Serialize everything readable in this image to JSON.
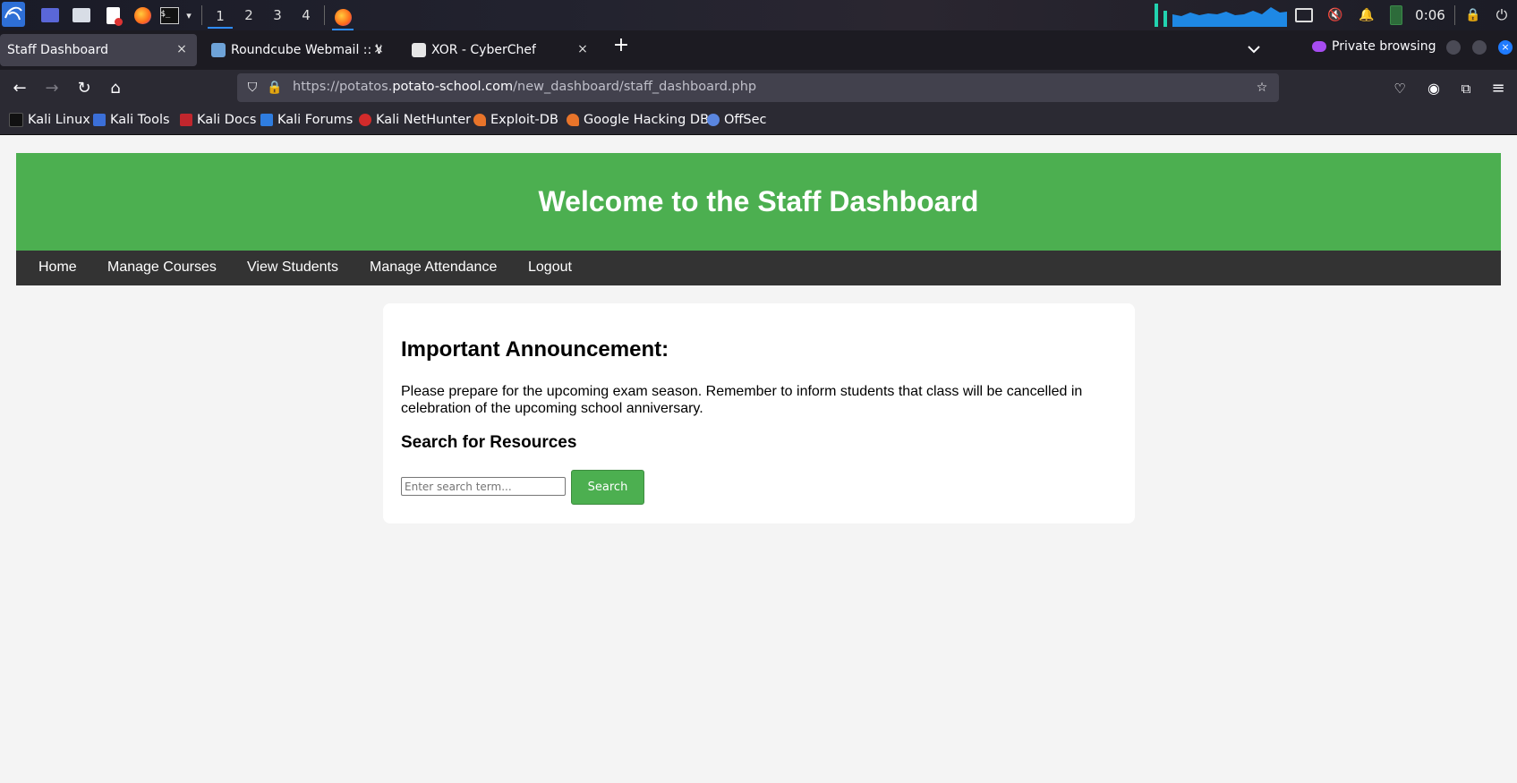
{
  "panel": {
    "workspaces": [
      "1",
      "2",
      "3",
      "4"
    ],
    "clock": "0:06",
    "icons": [
      "kali-menu-icon",
      "desktop-icon",
      "file-manager-icon",
      "text-editor-icon",
      "firefox-icon",
      "terminal-icon",
      "chevron-down-icon",
      "firefox-icon",
      "display-icon",
      "mute-icon",
      "bell-icon",
      "battery-icon",
      "lock-icon",
      "power-icon"
    ]
  },
  "browser": {
    "tabs": [
      {
        "title": "Staff Dashboard",
        "selected": true
      },
      {
        "title": "Roundcube Webmail :: W",
        "selected": false
      },
      {
        "title": "XOR - CyberChef",
        "selected": false
      }
    ],
    "new_tab": "+",
    "private_label": "Private browsing",
    "close_glyph": "×",
    "url": {
      "prefix": "https://potatos.",
      "host": "potato-school.com",
      "path": "/new_dashboard/staff_dashboard.php"
    },
    "bookmarks": [
      {
        "label": "Kali Linux",
        "color": "#111111"
      },
      {
        "label": "Kali Tools",
        "color": "#3b6fd8"
      },
      {
        "label": "Kali Docs",
        "color": "#c0262d"
      },
      {
        "label": "Kali Forums",
        "color": "#2f7de0"
      },
      {
        "label": "Kali NetHunter",
        "color": "#d22b2b"
      },
      {
        "label": "Exploit-DB",
        "color": "#e8742a"
      },
      {
        "label": "Google Hacking DB",
        "color": "#e8742a"
      },
      {
        "label": "OffSec",
        "color": "#5a86e0"
      }
    ]
  },
  "site": {
    "header_title": "Welcome to the Staff Dashboard",
    "nav": [
      "Home",
      "Manage Courses",
      "View Students",
      "Manage Attendance",
      "Logout"
    ],
    "announcement_heading": "Important Announcement:",
    "announcement_text": "Please prepare for the upcoming exam season. Remember to inform students that class will be cancelled in celebration of the upcoming school anniversary.",
    "search_heading": "Search for Resources",
    "search_placeholder": "Enter search term...",
    "search_button": "Search",
    "colors": {
      "accent": "#4caf50",
      "nav_bg": "#333333",
      "page_bg": "#f4f4f4"
    }
  }
}
